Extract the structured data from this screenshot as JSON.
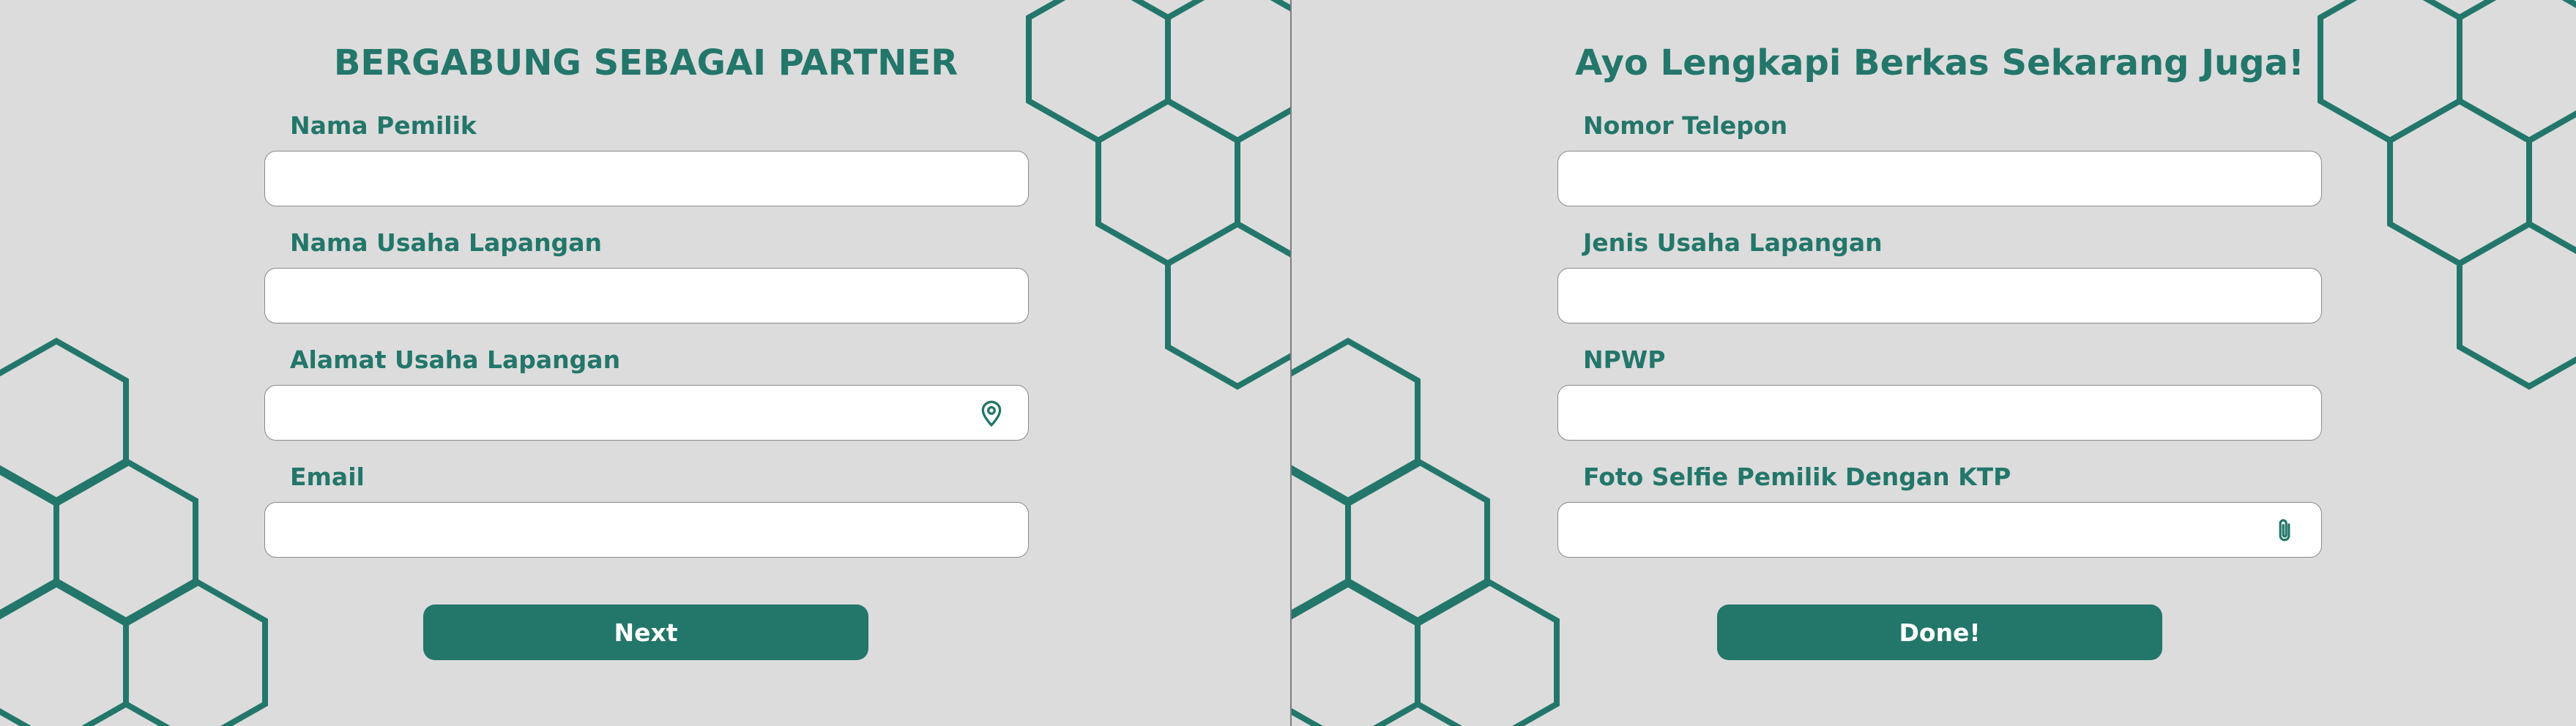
{
  "left_panel": {
    "title": "BERGABUNG SEBAGAI PARTNER",
    "fields": [
      {
        "label": "Nama Pemilik",
        "value": "",
        "placeholder": ""
      },
      {
        "label": "Nama Usaha Lapangan",
        "value": "",
        "placeholder": ""
      },
      {
        "label": "Alamat Usaha Lapangan",
        "value": "",
        "placeholder": "",
        "icon": "map-pin-icon"
      },
      {
        "label": "Email",
        "value": "",
        "placeholder": ""
      }
    ],
    "button_label": "Next"
  },
  "right_panel": {
    "title": "Ayo Lengkapi Berkas Sekarang Juga!",
    "fields": [
      {
        "label": "Nomor Telepon",
        "value": "",
        "placeholder": ""
      },
      {
        "label": "Jenis Usaha Lapangan",
        "value": "",
        "placeholder": ""
      },
      {
        "label": "NPWP",
        "value": "",
        "placeholder": ""
      },
      {
        "label": "Foto Selfie Pemilik Dengan KTP",
        "value": "",
        "placeholder": "",
        "icon": "paperclip-icon"
      }
    ],
    "button_label": "Done!"
  },
  "colors": {
    "accent": "#23766a",
    "background": "#dcdcdc",
    "field_background": "#ffffff",
    "field_border": "#8a8a8a",
    "button_text": "#ffffff"
  },
  "decoration": {
    "icon": "hexagon-pattern"
  }
}
